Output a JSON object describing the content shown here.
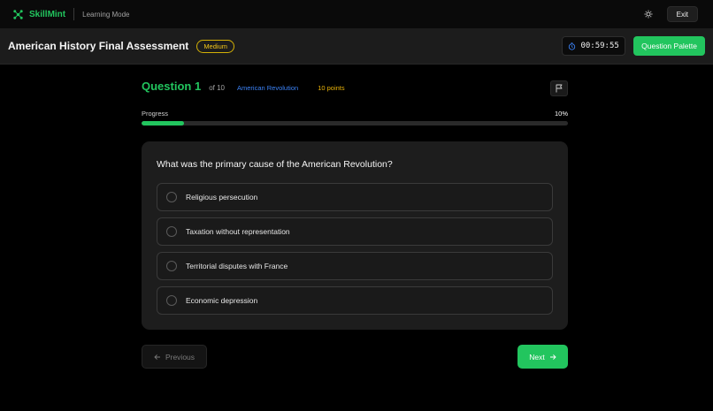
{
  "app": {
    "name": "SkillMint",
    "mode": "Learning Mode",
    "exit_label": "Exit",
    "accent": "#22c55e"
  },
  "header": {
    "title": "American History Final Assessment",
    "difficulty": "Medium",
    "timer": "00:59:55",
    "palette_label": "Question Palette"
  },
  "question": {
    "number_label": "Question 1",
    "of_label": "of 10",
    "topic": "American Revolution",
    "points": "10 points",
    "text": "What was the primary cause of the American Revolution?",
    "options": [
      {
        "label": "Religious persecution"
      },
      {
        "label": "Taxation without representation"
      },
      {
        "label": "Territorial disputes with France"
      },
      {
        "label": "Economic depression"
      }
    ]
  },
  "progress": {
    "label": "Progress",
    "value_label": "10%",
    "fraction": 0.1
  },
  "nav": {
    "previous_label": "Previous",
    "next_label": "Next"
  },
  "icons": {
    "logo": "skillmint-logo-icon",
    "theme": "sun-icon",
    "timer": "clock-icon",
    "flag": "flag-icon",
    "previous": "arrow-left-icon",
    "next": "arrow-right-icon"
  }
}
